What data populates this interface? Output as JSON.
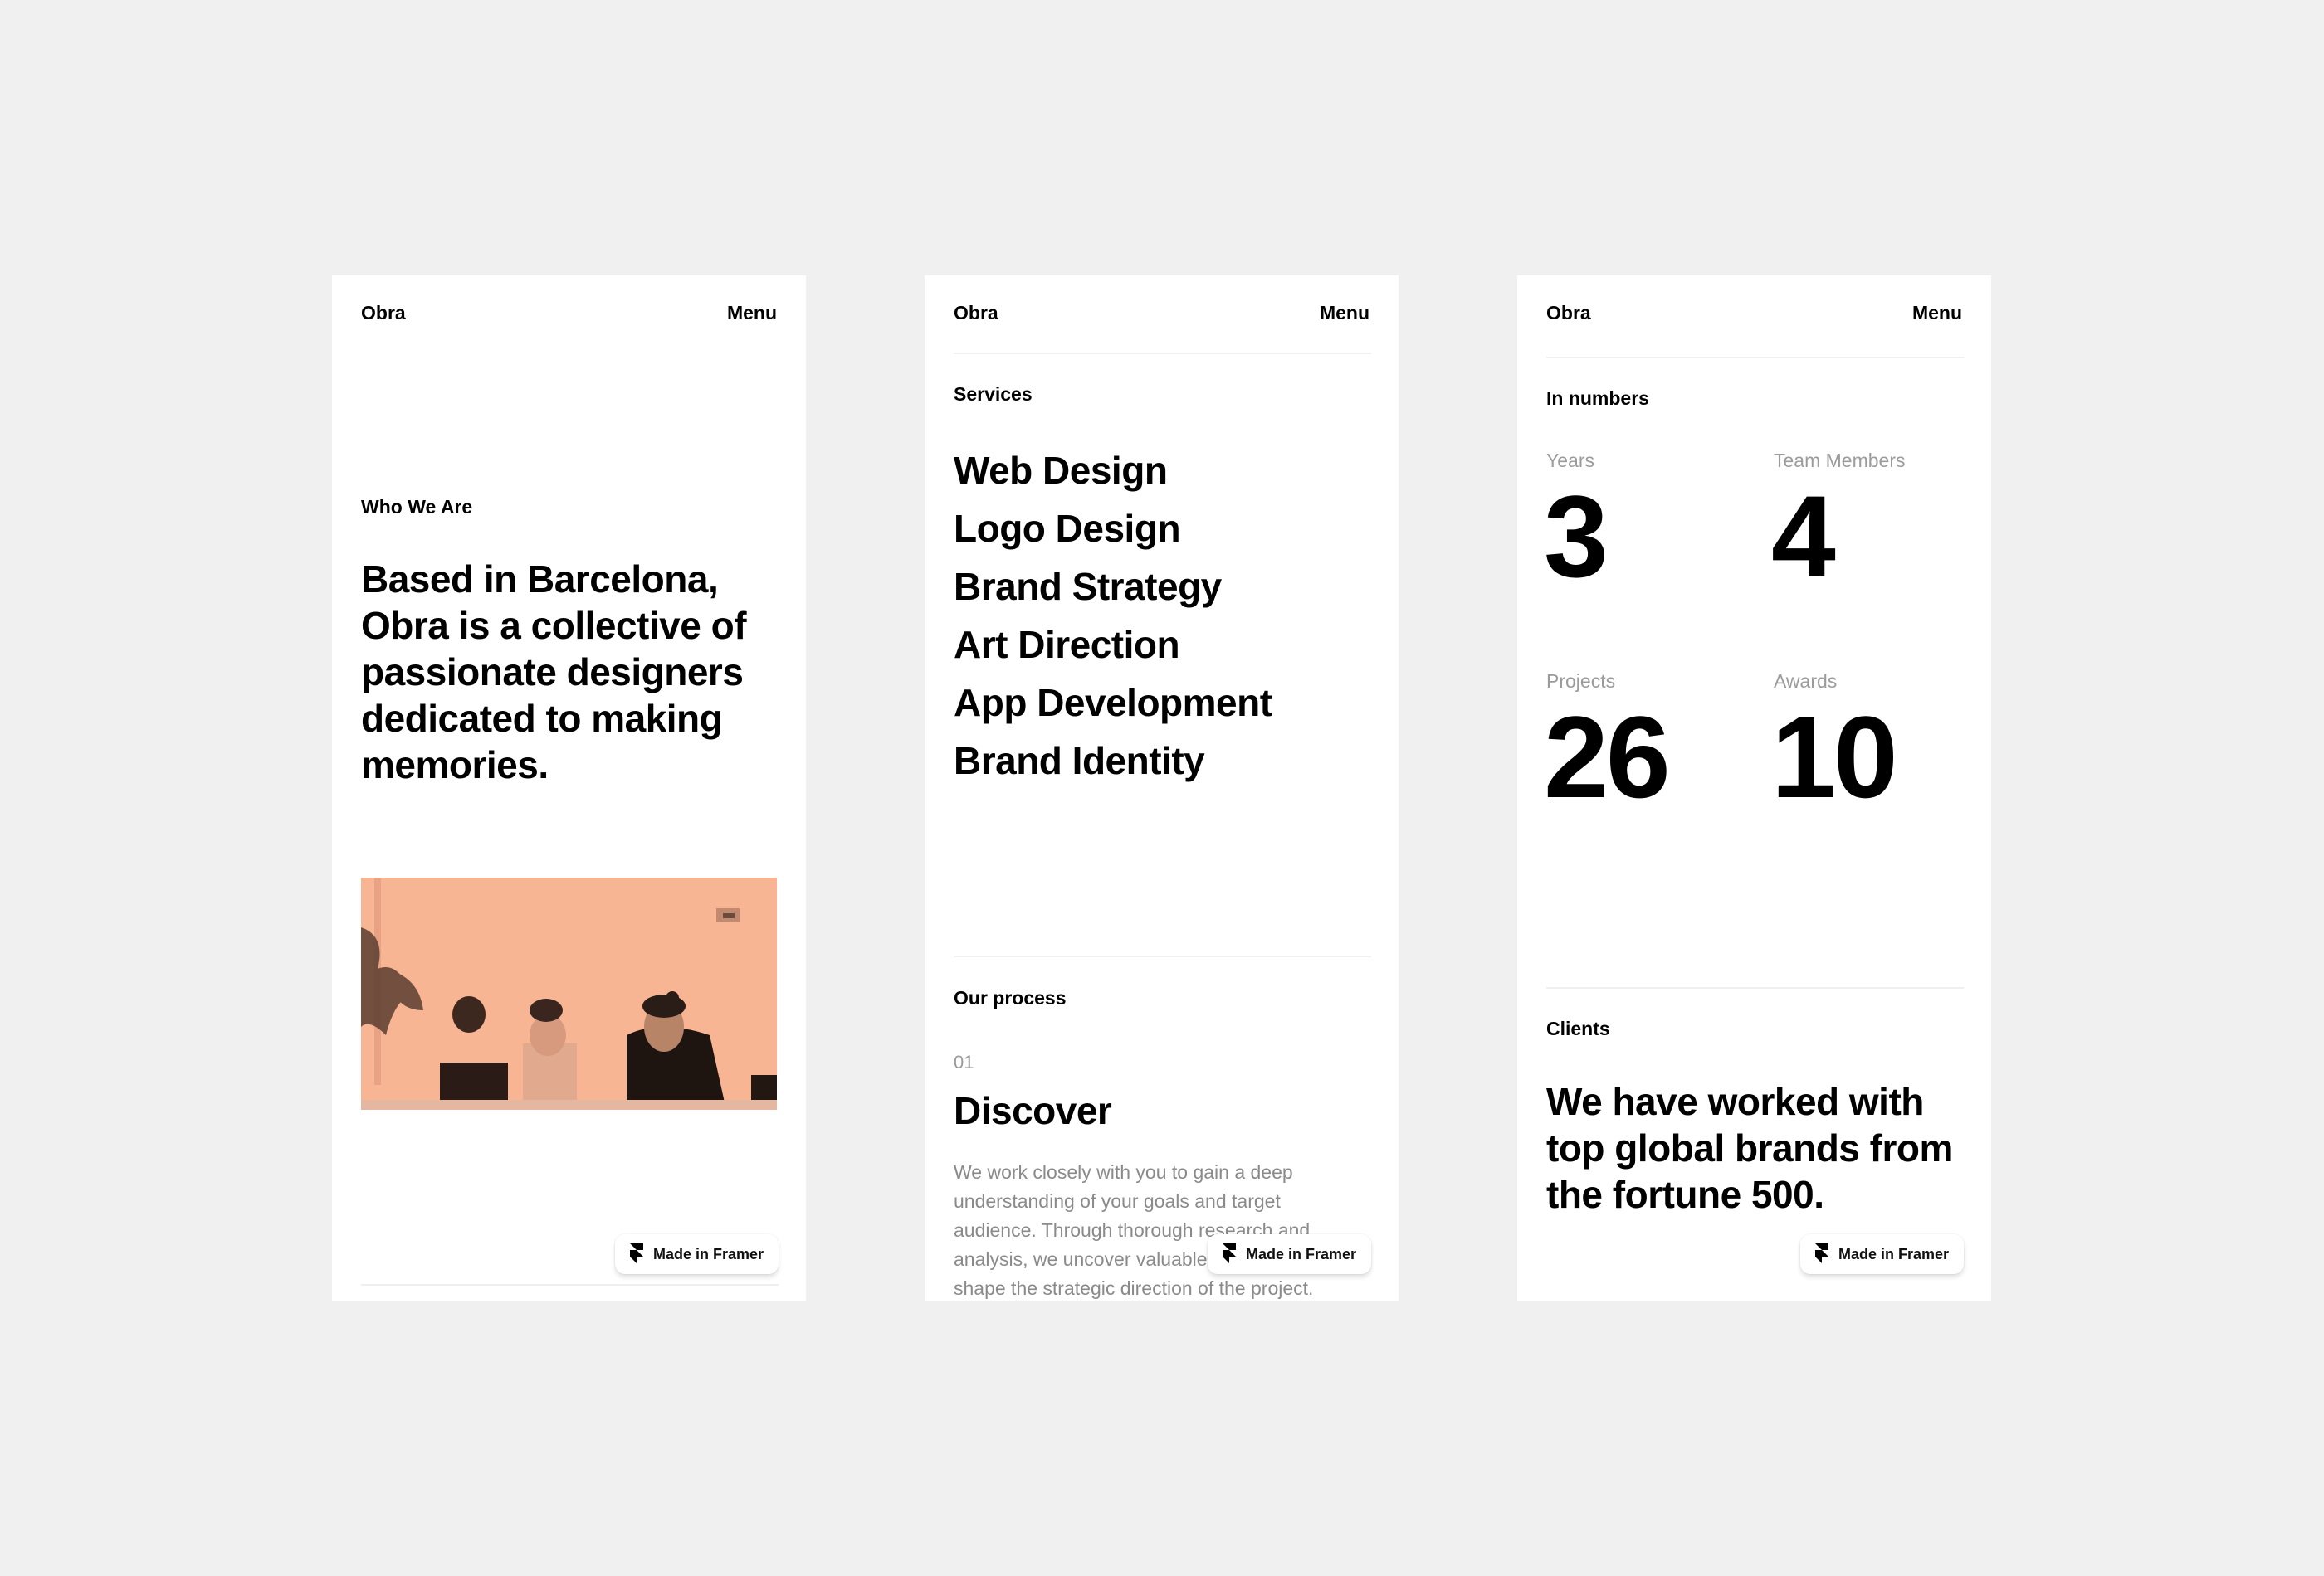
{
  "colors": {
    "page_bg": "#f0f0f0",
    "card_bg": "#ffffff",
    "photo_tint": "#f7b594",
    "muted_text": "#9a9a9a"
  },
  "nav": {
    "brand": "Obra",
    "menu": "Menu"
  },
  "badge": {
    "label": "Made in Framer",
    "icon": "framer-logo-icon"
  },
  "about": {
    "label": "Who We Are",
    "lead": "Based in Barcelona, Obra is a collective of passionate designers dedicated to making memories.",
    "photo_alt": "Two designers working at laptops"
  },
  "services": {
    "label": "Services",
    "items": [
      "Web Design",
      "Logo Design",
      "Brand Strategy",
      "Art Direction",
      "App Development",
      "Brand Identity"
    ]
  },
  "process": {
    "label": "Our process",
    "steps": [
      {
        "number": "01",
        "title": "Discover",
        "body": "We work closely with you to gain a deep understanding of your goals and target audience. Through thorough research and analysis, we uncover valuable insights that shape the strategic direction of the project."
      }
    ]
  },
  "numbers": {
    "label": "In numbers",
    "stats": [
      {
        "label": "Years",
        "value": "3"
      },
      {
        "label": "Team Members",
        "value": "4"
      },
      {
        "label": "Projects",
        "value": "26"
      },
      {
        "label": "Awards",
        "value": "10"
      }
    ]
  },
  "clients": {
    "label": "Clients",
    "lead": "We have worked with top global brands from the fortune 500."
  }
}
